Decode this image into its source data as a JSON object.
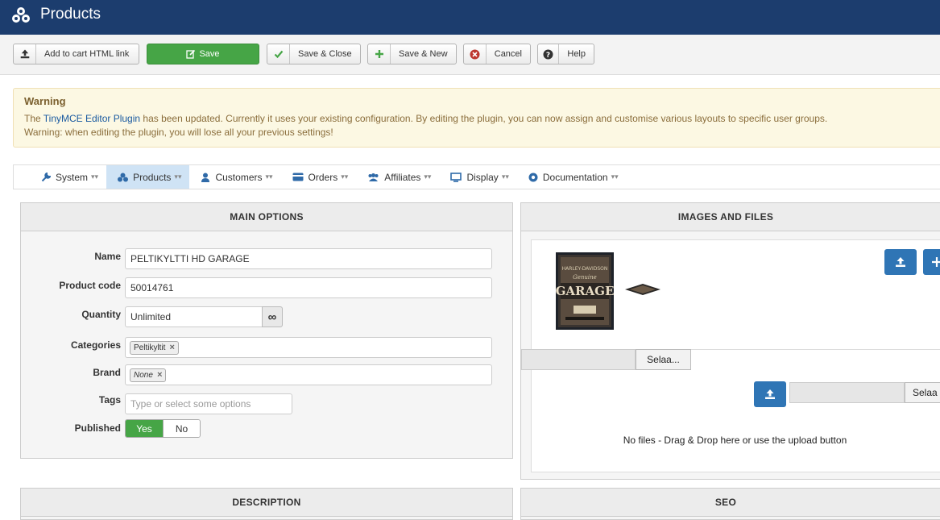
{
  "header": {
    "title": "Products"
  },
  "toolbar": {
    "add_to_cart": "Add to cart HTML link",
    "save": "Save",
    "save_close": "Save & Close",
    "save_new": "Save & New",
    "cancel": "Cancel",
    "help": "Help"
  },
  "warning": {
    "title": "Warning",
    "line1_prefix": "The ",
    "line1_link": "TinyMCE Editor Plugin",
    "line1_suffix": " has been updated. Currently it uses your existing configuration. By editing the plugin, you can now assign and customise various layouts to specific user groups.",
    "line2": "Warning: when editing the plugin, you will lose all your previous settings!"
  },
  "nav": {
    "items": [
      {
        "label": "System",
        "icon": "wrench-icon"
      },
      {
        "label": "Products",
        "icon": "cubes-icon"
      },
      {
        "label": "Customers",
        "icon": "user-icon"
      },
      {
        "label": "Orders",
        "icon": "credit-card-icon"
      },
      {
        "label": "Affiliates",
        "icon": "users-icon"
      },
      {
        "label": "Display",
        "icon": "monitor-icon"
      },
      {
        "label": "Documentation",
        "icon": "help-circle-icon"
      }
    ],
    "active": "Products"
  },
  "main_options": {
    "heading": "MAIN OPTIONS",
    "name_label": "Name",
    "name_value": "PELTIKYLTTI HD GARAGE",
    "code_label": "Product code",
    "code_value": "50014761",
    "quantity_label": "Quantity",
    "quantity_value": "Unlimited",
    "categories_label": "Categories",
    "categories_chip": "Peltikyltit",
    "brand_label": "Brand",
    "brand_chip": "None",
    "tags_label": "Tags",
    "tags_placeholder": "Type or select some options",
    "published_label": "Published",
    "yes": "Yes",
    "no": "No"
  },
  "images_files": {
    "heading": "IMAGES AND FILES",
    "browse1": "Selaa...",
    "browse2": "Selaa",
    "no_files": "No files - Drag & Drop here or use the upload button"
  },
  "description": {
    "heading": "DESCRIPTION"
  },
  "seo": {
    "heading": "SEO"
  },
  "colors": {
    "header": "#1c3d6e",
    "save": "#46a546",
    "upload": "#2f75b5",
    "active_nav": "#cfe3f5"
  }
}
